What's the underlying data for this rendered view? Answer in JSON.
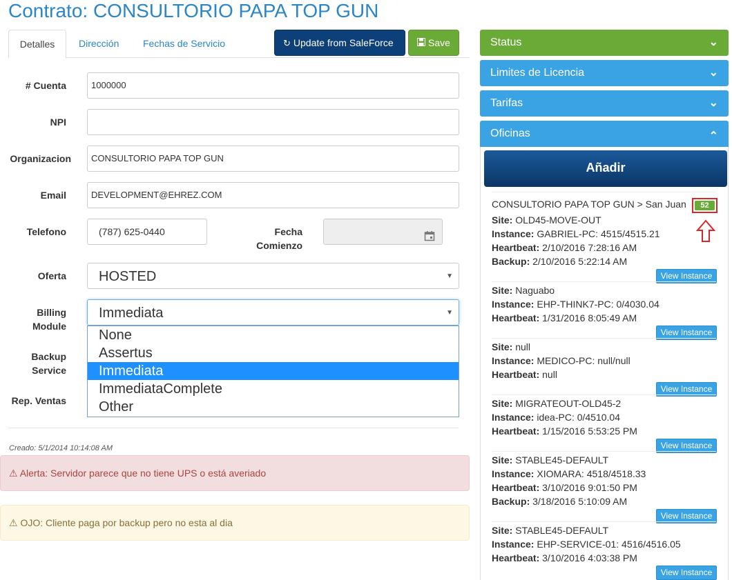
{
  "page": {
    "title": "Contrato: CONSULTORIO PAPA TOP GUN"
  },
  "tabs": [
    {
      "label": "Detalles"
    },
    {
      "label": "Dirección"
    },
    {
      "label": "Fechas de Servicio"
    }
  ],
  "toolbar": {
    "salesforce_label": "Update from SaleForce",
    "save_label": "Save",
    "refresh_icon": "refresh-icon",
    "save_icon": "floppy-icon"
  },
  "form": {
    "cuenta": {
      "label": "# Cuenta",
      "value": "1000000"
    },
    "npi": {
      "label": "NPI",
      "value": ""
    },
    "organizacion": {
      "label": "Organizacion",
      "value": "CONSULTORIO PAPA TOP GUN"
    },
    "email": {
      "label": "Email",
      "value": "DEVELOPMENT@EHREZ.COM"
    },
    "telefono": {
      "label": "Telefono",
      "value": "(787) 625-0440"
    },
    "fecha_comienzo": {
      "label_line1": "Fecha",
      "label_line2": "Comienzo",
      "value": ""
    },
    "oferta": {
      "label": "Oferta",
      "value": "HOSTED"
    },
    "billing": {
      "label_line1": "Billing",
      "label_line2": "Module",
      "value": "Immediata",
      "options": [
        "None",
        "Assertus",
        "Immediata",
        "ImmediataComplete",
        "Other"
      ],
      "selected_index": 2
    },
    "backup": {
      "label_line1": "Backup",
      "label_line2": "Service"
    },
    "rep_ventas": {
      "label": "Rep. Ventas"
    }
  },
  "created": "Creado: 5/1/2014 10:14:08 AM",
  "alerts": {
    "danger": "Alerta: Servidor parece que no tiene UPS o está averiado",
    "warning": "OJO: Cliente paga por backup pero no esta al dia"
  },
  "panels": {
    "status": "Status",
    "limites": "Limites de Licencia",
    "tarifas": "Tarifas",
    "oficinas": "Oficinas",
    "add_label": "Añadir"
  },
  "office": {
    "header": "CONSULTORIO PAPA TOP GUN > San Juan",
    "badge": "52",
    "view_label": "View Instance",
    "sites": [
      {
        "site": "OLD45-MOVE-OUT",
        "instance": "GABRIEL-PC: 4515/4515.21",
        "heartbeat": "2/10/2016 7:28:16 AM",
        "backup": "2/10/2016 5:22:14 AM"
      },
      {
        "site": "Naguabo",
        "instance": "EHP-THINK7-PC: 0/4030.04",
        "heartbeat": "1/31/2016 8:05:49 AM"
      },
      {
        "site": "null",
        "instance": "MEDICO-PC: null/null",
        "heartbeat": "null"
      },
      {
        "site": "MIGRATEOUT-OLD45-2",
        "instance": "idea-PC: 0/4510.04",
        "heartbeat": "1/15/2016 5:53:25 PM"
      },
      {
        "site": "STABLE45-DEFAULT",
        "instance": "XIOMARA: 4518/4518.33",
        "heartbeat": "3/10/2016 9:01:50 PM",
        "backup": "3/18/2016 5:10:09 AM"
      },
      {
        "site": "STABLE45-DEFAULT",
        "instance": "EHP-SERVICE-01: 4516/4516.05",
        "heartbeat": "3/10/2016 4:03:38 PM"
      }
    ]
  },
  "field_labels": {
    "site": "Site:",
    "instance": "Instance:",
    "heartbeat": "Heartbeat:",
    "backup": "Backup:"
  },
  "colors": {
    "primary": "#2a86c8",
    "success": "#6aaa37",
    "info": "#3aa3e3",
    "navy": "#0d3f78",
    "highlight": "#d9262a"
  }
}
